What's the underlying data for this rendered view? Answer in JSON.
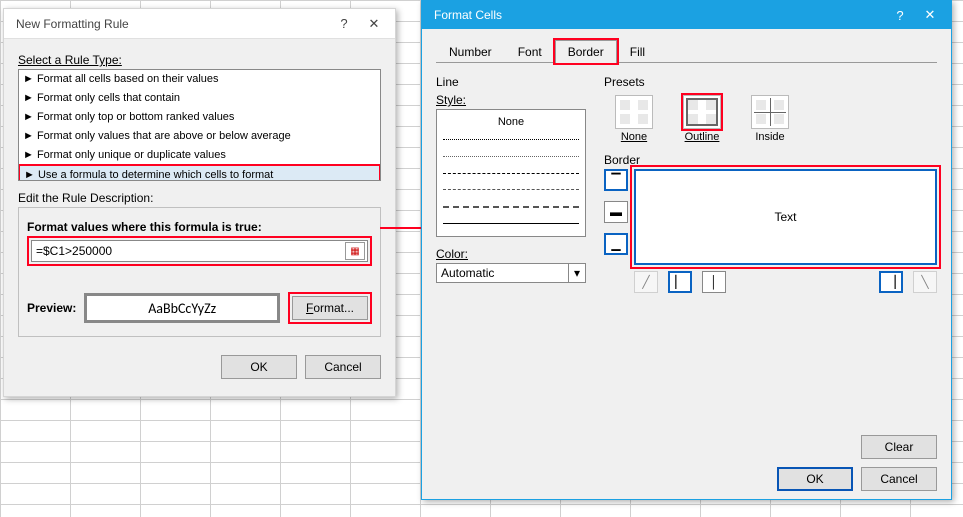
{
  "dlg1": {
    "title": "New Formatting Rule",
    "select_label": "Select a Rule Type:",
    "rules": [
      "► Format all cells based on their values",
      "► Format only cells that contain",
      "► Format only top or bottom ranked values",
      "► Format only values that are above or below average",
      "► Format only unique or duplicate values",
      "► Use a formula to determine which cells to format"
    ],
    "edit_label": "Edit the Rule Description:",
    "formula_label": "Format values where this formula is true:",
    "formula_value": "=$C1>250000",
    "preview_label": "Preview:",
    "preview_sample": "AaBbCcYyZz",
    "format_btn": "Format...",
    "ok": "OK",
    "cancel": "Cancel"
  },
  "dlg2": {
    "title": "Format Cells",
    "help": "?",
    "close": "✕",
    "tabs": [
      "Number",
      "Font",
      "Border",
      "Fill"
    ],
    "active_tab": "Border",
    "line_label": "Line",
    "style_label": "Style:",
    "style_none": "None",
    "color_label": "Color:",
    "color_value": "Automatic",
    "presets_label": "Presets",
    "preset_none": "None",
    "preset_outline": "Outline",
    "preset_inside": "Inside",
    "border_label": "Border",
    "preview_text": "Text",
    "clear": "Clear",
    "ok": "OK",
    "cancel": "Cancel"
  }
}
